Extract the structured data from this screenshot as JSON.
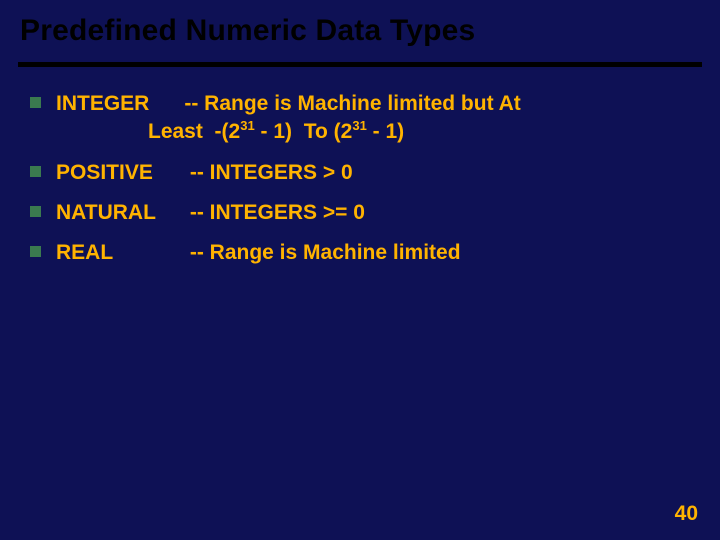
{
  "title": "Predefined Numeric Data Types",
  "items": [
    {
      "name": "INTEGER",
      "desc_line1": "-- Range is Machine limited but At",
      "desc_line2a": "Least",
      "exp": "31",
      "minus": " - 1",
      "to": "To"
    },
    {
      "name": "POSITIVE",
      "desc": "-- INTEGERS  > 0"
    },
    {
      "name": "NATURAL",
      "desc": "-- INTEGERS      >= 0"
    },
    {
      "name": "REAL",
      "desc": "-- Range is Machine limited"
    }
  ],
  "page_number": "40"
}
